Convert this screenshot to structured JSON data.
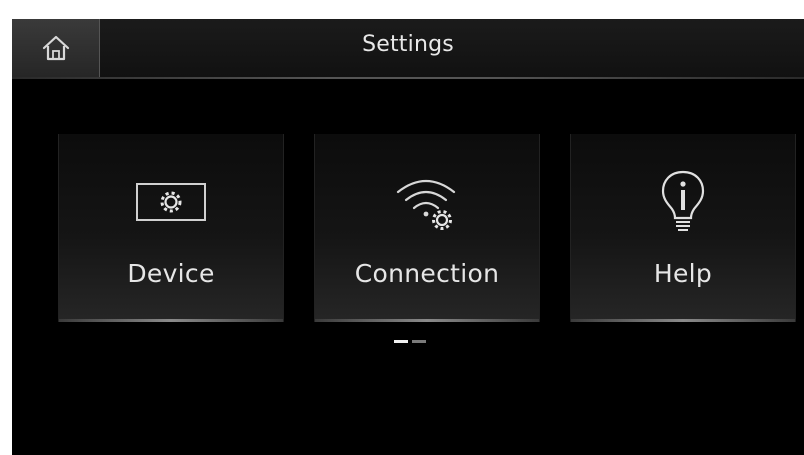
{
  "header": {
    "title": "Settings",
    "home_icon": "home-icon"
  },
  "tiles": [
    {
      "label": "Device",
      "icon": "device-settings-icon"
    },
    {
      "label": "Connection",
      "icon": "wifi-settings-icon"
    },
    {
      "label": "Help",
      "icon": "lightbulb-info-icon"
    }
  ],
  "pager": {
    "total_pages": 2,
    "current_page": 1
  },
  "colors": {
    "background": "#000000",
    "text": "#e6e6e6",
    "accent_line": "#8a8a8a"
  }
}
